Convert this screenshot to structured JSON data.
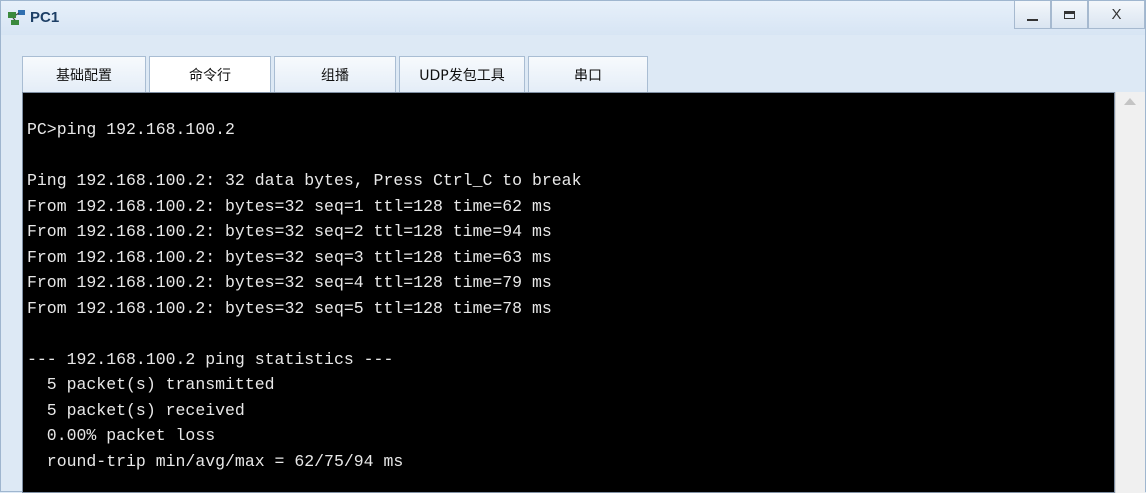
{
  "window": {
    "title": "PC1",
    "close_label": "X"
  },
  "tabs": [
    {
      "label": "基础配置"
    },
    {
      "label": "命令行"
    },
    {
      "label": "组播"
    },
    {
      "label": "UDP发包工具"
    },
    {
      "label": "串口"
    }
  ],
  "terminal": {
    "lines": [
      "PC>ping 192.168.100.2",
      "",
      "Ping 192.168.100.2: 32 data bytes, Press Ctrl_C to break",
      "From 192.168.100.2: bytes=32 seq=1 ttl=128 time=62 ms",
      "From 192.168.100.2: bytes=32 seq=2 ttl=128 time=94 ms",
      "From 192.168.100.2: bytes=32 seq=3 ttl=128 time=63 ms",
      "From 192.168.100.2: bytes=32 seq=4 ttl=128 time=79 ms",
      "From 192.168.100.2: bytes=32 seq=5 ttl=128 time=78 ms",
      "",
      "--- 192.168.100.2 ping statistics ---",
      "  5 packet(s) transmitted",
      "  5 packet(s) received",
      "  0.00% packet loss",
      "  round-trip min/avg/max = 62/75/94 ms"
    ]
  },
  "colors": {
    "terminal_bg": "#000000",
    "terminal_fg": "#e8e8e8",
    "window_bg": "#dde9f5",
    "title_color": "#1d3f66"
  },
  "icons": {
    "app": "network-pc-icon",
    "minimize": "minimize-icon",
    "maximize": "maximize-icon",
    "close": "close-icon"
  }
}
